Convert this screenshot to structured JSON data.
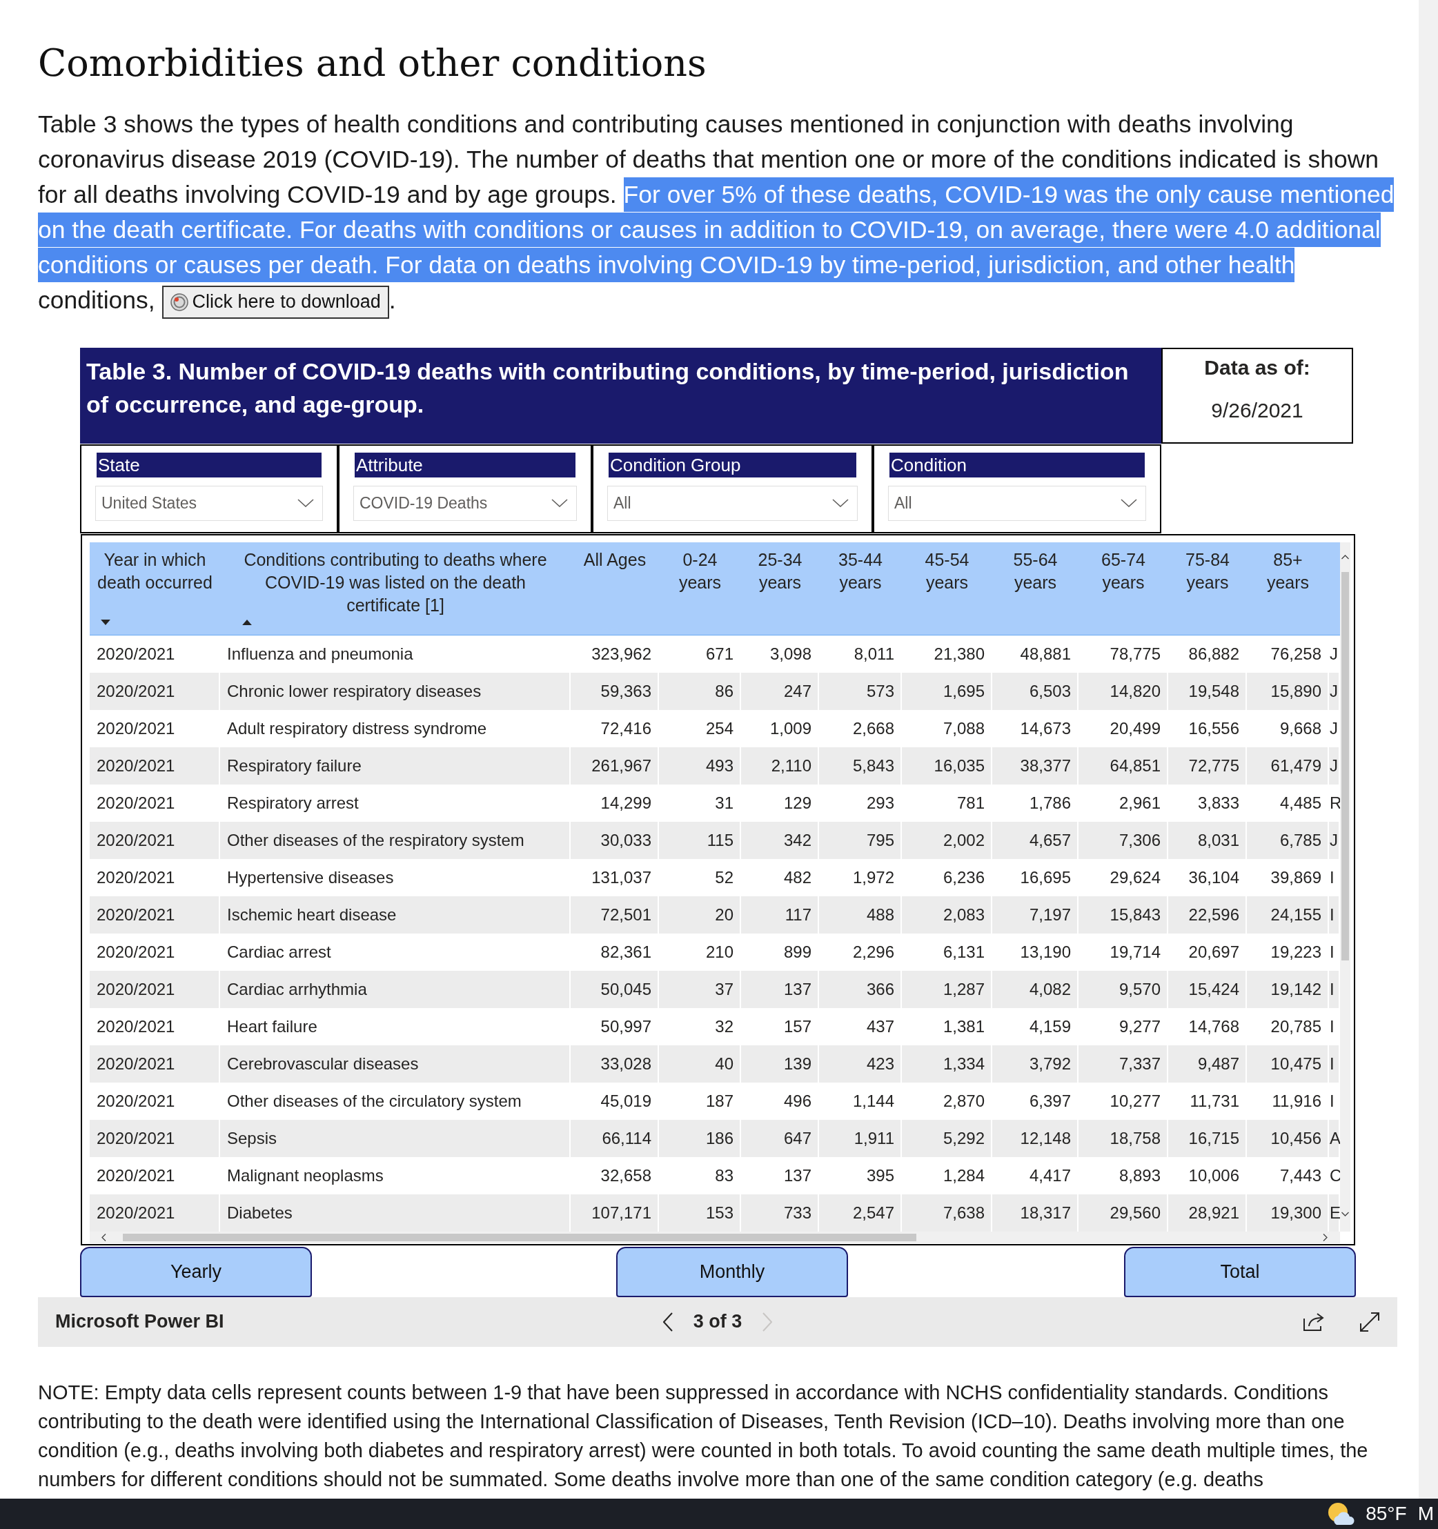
{
  "heading": "Comorbidities and other conditions",
  "intro": {
    "segments": [
      {
        "text": "Table 3 shows the types of health conditions and contributing causes mentioned in conjunction with deaths involving coronavirus disease 2019 (COVID-19). The number of deaths that mention one or more of the conditions indicated is shown for all deaths involving COVID-19 and by age groups.",
        "highlighted": false
      },
      {
        "text": "For over 5% of these deaths, COVID-19 was the only cause mentioned on the death certificate. For deaths with conditions or causes in addition to COVID-19, on average, there were 4.0 additional conditions or causes per death. For data on deaths involving COVID-19 by time-period, jurisdiction, and other health",
        "highlighted": true
      },
      {
        "text": "conditions,",
        "highlighted": false
      }
    ],
    "download_button": "Click here to download",
    "after_button": "."
  },
  "report": {
    "title": "Table 3. Number of COVID-19 deaths with contributing conditions, by time-period, jurisdiction of occurrence, and age-group.",
    "data_as_of": {
      "label": "Data as of:",
      "value": "9/26/2021"
    },
    "slicers": [
      {
        "label": "State",
        "value": "United States"
      },
      {
        "label": "Attribute",
        "value": "COVID-19 Deaths"
      },
      {
        "label": "Condition Group",
        "value": "All"
      },
      {
        "label": "Condition",
        "value": "All"
      }
    ],
    "table": {
      "columns": [
        {
          "label": "Year in which death occurred",
          "sorted_descending": true,
          "sorted_ascending": false
        },
        {
          "label": "Conditions contributing to deaths where COVID-19 was listed on the death certificate [1]",
          "sorted_descending": false,
          "sorted_ascending": true
        },
        {
          "label": "All Ages",
          "sorted_descending": false,
          "sorted_ascending": false
        },
        {
          "label": "0-24 years",
          "sorted_descending": false,
          "sorted_ascending": false
        },
        {
          "label": "25-34 years",
          "sorted_descending": false,
          "sorted_ascending": false
        },
        {
          "label": "35-44 years",
          "sorted_descending": false,
          "sorted_ascending": false
        },
        {
          "label": "45-54 years",
          "sorted_descending": false,
          "sorted_ascending": false
        },
        {
          "label": "55-64 years",
          "sorted_descending": false,
          "sorted_ascending": false
        },
        {
          "label": "65-74 years",
          "sorted_descending": false,
          "sorted_ascending": false
        },
        {
          "label": "75-84 years",
          "sorted_descending": false,
          "sorted_ascending": false
        },
        {
          "label": "85+ years",
          "sorted_descending": false,
          "sorted_ascending": false
        }
      ],
      "rows": [
        [
          "2020/2021",
          "Influenza and pneumonia",
          "323,962",
          "671",
          "3,098",
          "8,011",
          "21,380",
          "48,881",
          "78,775",
          "86,882",
          "76,258",
          "J"
        ],
        [
          "2020/2021",
          "Chronic lower respiratory diseases",
          "59,363",
          "86",
          "247",
          "573",
          "1,695",
          "6,503",
          "14,820",
          "19,548",
          "15,890",
          "J"
        ],
        [
          "2020/2021",
          "Adult respiratory distress syndrome",
          "72,416",
          "254",
          "1,009",
          "2,668",
          "7,088",
          "14,673",
          "20,499",
          "16,556",
          "9,668",
          "J"
        ],
        [
          "2020/2021",
          "Respiratory failure",
          "261,967",
          "493",
          "2,110",
          "5,843",
          "16,035",
          "38,377",
          "64,851",
          "72,775",
          "61,479",
          "J"
        ],
        [
          "2020/2021",
          "Respiratory arrest",
          "14,299",
          "31",
          "129",
          "293",
          "781",
          "1,786",
          "2,961",
          "3,833",
          "4,485",
          "R"
        ],
        [
          "2020/2021",
          "Other diseases of the respiratory system",
          "30,033",
          "115",
          "342",
          "795",
          "2,002",
          "4,657",
          "7,306",
          "8,031",
          "6,785",
          "J"
        ],
        [
          "2020/2021",
          "Hypertensive diseases",
          "131,037",
          "52",
          "482",
          "1,972",
          "6,236",
          "16,695",
          "29,624",
          "36,104",
          "39,869",
          "I"
        ],
        [
          "2020/2021",
          "Ischemic heart disease",
          "72,501",
          "20",
          "117",
          "488",
          "2,083",
          "7,197",
          "15,843",
          "22,596",
          "24,155",
          "I"
        ],
        [
          "2020/2021",
          "Cardiac arrest",
          "82,361",
          "210",
          "899",
          "2,296",
          "6,131",
          "13,190",
          "19,714",
          "20,697",
          "19,223",
          "I"
        ],
        [
          "2020/2021",
          "Cardiac arrhythmia",
          "50,045",
          "37",
          "137",
          "366",
          "1,287",
          "4,082",
          "9,570",
          "15,424",
          "19,142",
          "I"
        ],
        [
          "2020/2021",
          "Heart failure",
          "50,997",
          "32",
          "157",
          "437",
          "1,381",
          "4,159",
          "9,277",
          "14,768",
          "20,785",
          "I"
        ],
        [
          "2020/2021",
          "Cerebrovascular diseases",
          "33,028",
          "40",
          "139",
          "423",
          "1,334",
          "3,792",
          "7,337",
          "9,487",
          "10,475",
          "I"
        ],
        [
          "2020/2021",
          "Other diseases of the circulatory system",
          "45,019",
          "187",
          "496",
          "1,144",
          "2,870",
          "6,397",
          "10,277",
          "11,731",
          "11,916",
          "I"
        ],
        [
          "2020/2021",
          "Sepsis",
          "66,114",
          "186",
          "647",
          "1,911",
          "5,292",
          "12,148",
          "18,758",
          "16,715",
          "10,456",
          "A"
        ],
        [
          "2020/2021",
          "Malignant neoplasms",
          "32,658",
          "83",
          "137",
          "395",
          "1,284",
          "4,417",
          "8,893",
          "10,006",
          "7,443",
          "C"
        ],
        [
          "2020/2021",
          "Diabetes",
          "107,171",
          "153",
          "733",
          "2,547",
          "7,638",
          "18,317",
          "29,560",
          "28,921",
          "19,300",
          "E"
        ]
      ]
    },
    "buttons": [
      "Yearly",
      "Monthly",
      "Total"
    ]
  },
  "footer": {
    "brand": "Microsoft Power BI",
    "page_label": "3 of 3",
    "previous": {
      "disabled": false
    },
    "next": {
      "disabled": true
    }
  },
  "note": "NOTE: Empty data cells represent counts between 1-9 that have been suppressed in accordance with NCHS confidentiality standards. Conditions contributing to the death were identified using the International Classification of Diseases, Tenth Revision (ICD–10). Deaths involving more than one condition (e.g., deaths involving both diabetes and respiratory arrest) were counted in both totals. To avoid counting the same death multiple times, the numbers for different conditions should not be summated. Some deaths involve more than one of the same condition category (e.g. deaths",
  "taskbar": {
    "temperature": "85°F",
    "weather": "M"
  }
}
